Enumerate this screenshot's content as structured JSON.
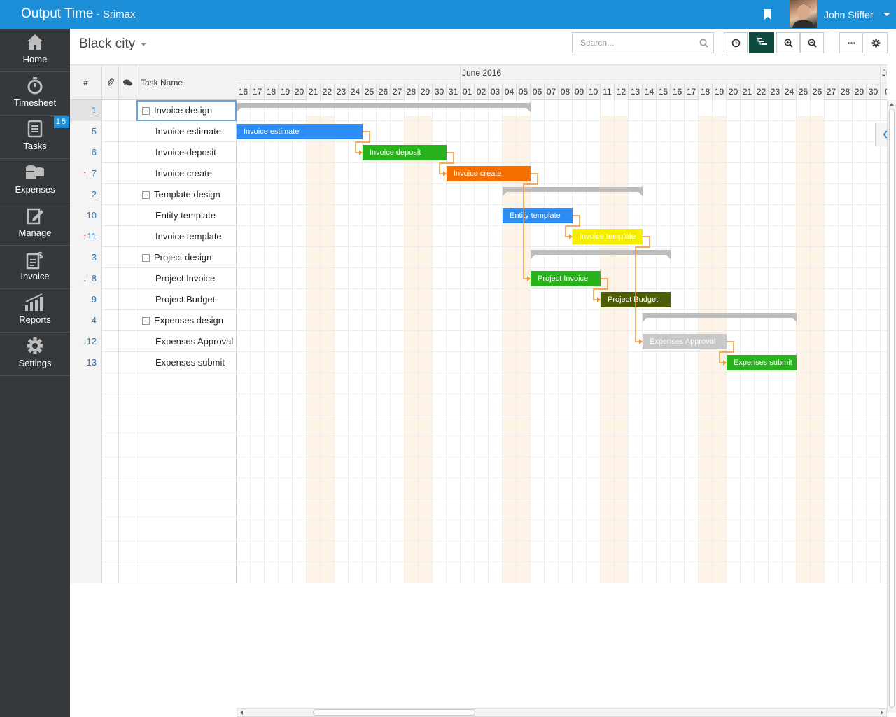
{
  "app": {
    "title": "Output Time",
    "subtitle": " - Srimax"
  },
  "user": {
    "name": "John Stiffer"
  },
  "sidebar": {
    "items": [
      {
        "label": "Home",
        "icon": "home-icon"
      },
      {
        "label": "Timesheet",
        "icon": "stopwatch-icon"
      },
      {
        "label": "Tasks",
        "icon": "tasks-icon",
        "badge": "15"
      },
      {
        "label": "Expenses",
        "icon": "coins-icon"
      },
      {
        "label": "Manage",
        "icon": "edit-icon"
      },
      {
        "label": "Invoice",
        "icon": "invoice-icon"
      },
      {
        "label": "Reports",
        "icon": "chart-icon"
      },
      {
        "label": "Settings",
        "icon": "gear-icon"
      }
    ]
  },
  "project": {
    "name": "Black city"
  },
  "search": {
    "placeholder": "Search..."
  },
  "toolbar": {
    "buttons": [
      "clock-icon",
      "gantt-icon",
      "zoom-in-icon",
      "zoom-out-icon",
      "more-icon",
      "settings-icon"
    ],
    "active": "gantt-icon"
  },
  "grid": {
    "headers": {
      "num": "#",
      "name": "Task Name"
    },
    "rows": [
      {
        "num": "1",
        "name": "Invoice design",
        "group": true,
        "selected": true
      },
      {
        "num": "5",
        "name": "Invoice estimate"
      },
      {
        "num": "6",
        "name": "Invoice deposit"
      },
      {
        "num": "7",
        "name": "Invoice create",
        "priority": "up"
      },
      {
        "num": "2",
        "name": "Template design",
        "group": true
      },
      {
        "num": "10",
        "name": "Entity template"
      },
      {
        "num": "11",
        "name": "Invoice template",
        "priority": "up"
      },
      {
        "num": "3",
        "name": "Project design",
        "group": true
      },
      {
        "num": "8",
        "name": "Project Invoice",
        "priority": "down"
      },
      {
        "num": "9",
        "name": "Project Budget"
      },
      {
        "num": "4",
        "name": "Expenses design",
        "group": true
      },
      {
        "num": "12",
        "name": "Expenses Approval",
        "priority": "down"
      },
      {
        "num": "13",
        "name": "Expenses submit"
      }
    ],
    "empty_rows": 10
  },
  "gantt": {
    "months": [
      {
        "label": "June 2016",
        "day_index": 16
      },
      {
        "label": "Ju",
        "day_index": 46
      }
    ],
    "days": [
      "16",
      "17",
      "18",
      "19",
      "20",
      "21",
      "22",
      "23",
      "24",
      "25",
      "26",
      "27",
      "28",
      "29",
      "30",
      "31",
      "01",
      "02",
      "03",
      "04",
      "05",
      "06",
      "07",
      "08",
      "09",
      "10",
      "11",
      "12",
      "13",
      "14",
      "15",
      "16",
      "17",
      "18",
      "19",
      "20",
      "21",
      "22",
      "23",
      "24",
      "25",
      "26",
      "27",
      "28",
      "29",
      "30",
      "0"
    ],
    "weekend_days": [
      5,
      6,
      12,
      13,
      19,
      20,
      26,
      27,
      33,
      34,
      40,
      41
    ],
    "summaries": [
      {
        "row": 0,
        "start": 0,
        "end": 21
      },
      {
        "row": 4,
        "start": 19,
        "end": 29
      },
      {
        "row": 7,
        "start": 21,
        "end": 31
      },
      {
        "row": 10,
        "start": 29,
        "end": 40
      }
    ],
    "tasks": [
      {
        "row": 1,
        "label": "Invoice estimate",
        "start": 0,
        "end": 9,
        "color": "#2c8cf4"
      },
      {
        "row": 2,
        "label": "Invoice deposit",
        "start": 9,
        "end": 15,
        "color": "#29b11e"
      },
      {
        "row": 3,
        "label": "Invoice create",
        "start": 15,
        "end": 21,
        "color": "#f56f00"
      },
      {
        "row": 5,
        "label": "Entity template",
        "start": 19,
        "end": 24,
        "color": "#2c8cf4"
      },
      {
        "row": 6,
        "label": "Invoice template",
        "start": 24,
        "end": 29,
        "color": "#f6ee00"
      },
      {
        "row": 8,
        "label": "Project Invoice",
        "start": 21,
        "end": 26,
        "color": "#29b11e"
      },
      {
        "row": 9,
        "label": "Project Budget",
        "start": 26,
        "end": 31,
        "color": "#4b5e06"
      },
      {
        "row": 11,
        "label": "Expenses Approval",
        "start": 29,
        "end": 35,
        "color": "#c8c8c8"
      },
      {
        "row": 12,
        "label": "Expenses submit",
        "start": 35,
        "end": 40,
        "color": "#29b11e"
      }
    ],
    "links": [
      {
        "from": 1,
        "to": 2
      },
      {
        "from": 2,
        "to": 3
      },
      {
        "from": 3,
        "to": 8
      },
      {
        "from": 5,
        "to": 6
      },
      {
        "from": 6,
        "to": 11
      },
      {
        "from": 8,
        "to": 9
      },
      {
        "from": 11,
        "to": 12
      }
    ],
    "link_color": "#f3922b"
  }
}
